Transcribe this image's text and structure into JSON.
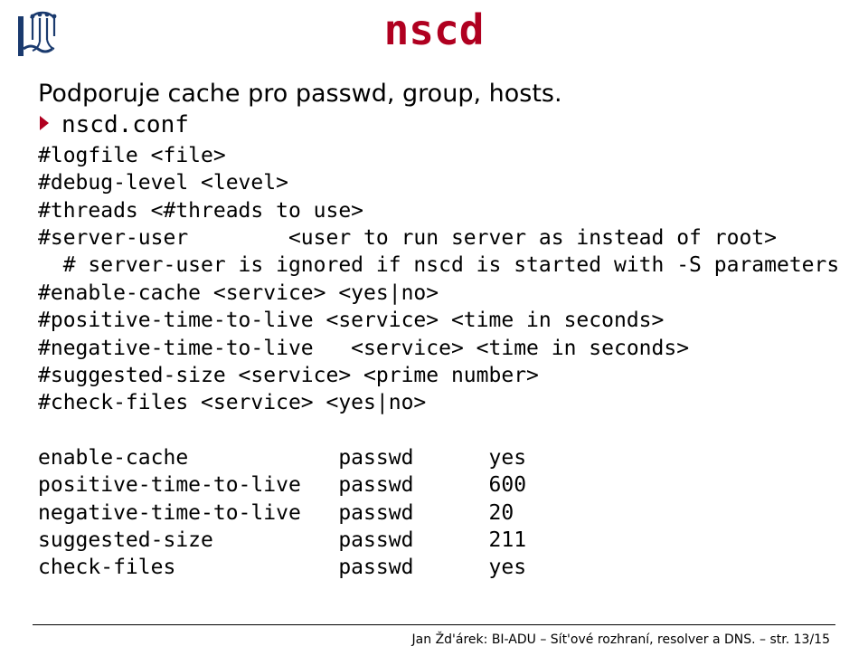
{
  "title": "nscd",
  "intro": "Podporuje cache pro passwd, group, hosts.",
  "bullet_file": "nscd.conf",
  "code_lines": [
    "#logfile <file>",
    "#debug-level <level>",
    "#threads <#threads to use>",
    "#server-user        <user to run server as instead of root>",
    "  # server-user is ignored if nscd is started with -S parameters",
    "#enable-cache <service> <yes|no>",
    "#positive-time-to-live <service> <time in seconds>",
    "#negative-time-to-live   <service> <time in seconds>",
    "#suggested-size <service> <prime number>",
    "#check-files <service> <yes|no>",
    "",
    "enable-cache            passwd      yes",
    "positive-time-to-live   passwd      600",
    "negative-time-to-live   passwd      20",
    "suggested-size          passwd      211",
    "check-files             passwd      yes"
  ],
  "footer": {
    "author": "Jan Žd'árek",
    "sep": ": ",
    "course": "BI-ADU – Sít'ové rozhraní, resolver a DNS.",
    "page": " – str. 13/15"
  }
}
